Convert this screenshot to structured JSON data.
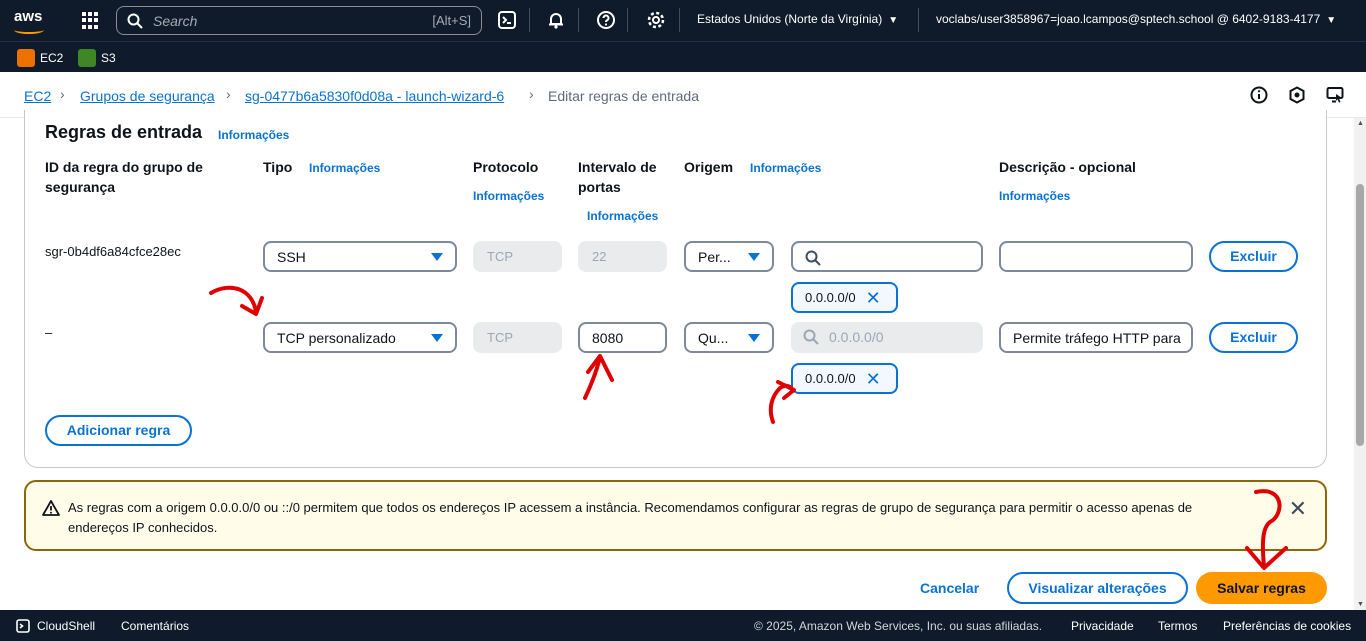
{
  "topbar": {
    "logo": "aws",
    "search_placeholder": "Search",
    "search_shortcut": "[Alt+S]",
    "region": "Estados Unidos (Norte da Virgínia)",
    "account": "voclabs/user3858967=joao.lcampos@sptech.school @ 6402-9183-4177",
    "icons": [
      "cloudshell-icon",
      "bell-icon",
      "help-icon",
      "gear-icon"
    ]
  },
  "favorites": [
    {
      "label": "EC2",
      "color": "#ed7100"
    },
    {
      "label": "S3",
      "color": "#3f8624"
    }
  ],
  "breadcrumb": {
    "items": [
      "EC2",
      "Grupos de segurança",
      "sg-0477b6a5830f0d08a - launch-wizard-6"
    ],
    "current": "Editar regras de entrada"
  },
  "panel": {
    "title": "Regras de entrada",
    "info_label": "Informações",
    "columns": {
      "rule_id": "ID da regra do grupo de segurança",
      "type": "Tipo",
      "protocol": "Protocolo",
      "port_range": "Intervalo de portas",
      "source": "Origem",
      "description": "Descrição - opcional"
    },
    "rows": [
      {
        "id": "sgr-0b4df6a84cfce28ec",
        "type": "SSH",
        "protocol": "TCP",
        "port": "22",
        "source_select": "Per...",
        "source_search": "",
        "source_token": "0.0.0.0/0",
        "description": "",
        "delete_label": "Excluir"
      },
      {
        "id": "–",
        "type": "TCP personalizado",
        "protocol": "TCP",
        "port": "8080",
        "source_select": "Qu...",
        "source_search": "0.0.0.0/0",
        "source_token": "0.0.0.0/0",
        "description": "Permite tráfego HTTP para",
        "delete_label": "Excluir"
      }
    ],
    "add_rule_label": "Adicionar regra"
  },
  "alert": {
    "message": "As regras com a origem 0.0.0.0/0 ou ::/0 permitem que todos os endereços IP acessem a instância. Recomendamos configurar as regras de grupo de segurança para permitir o acesso apenas de endereços IP conhecidos."
  },
  "actions": {
    "cancel": "Cancelar",
    "preview": "Visualizar alterações",
    "save": "Salvar regras"
  },
  "footer": {
    "cloudshell": "CloudShell",
    "feedback": "Comentários",
    "copyright": "© 2025, Amazon Web Services, Inc. ou suas afiliadas.",
    "privacy": "Privacidade",
    "terms": "Termos",
    "cookies": "Preferências de cookies"
  },
  "colors": {
    "nav_bg": "#0f1b2a",
    "link": "#0972d3",
    "primary": "#ff9900",
    "warning_border": "#8d6605",
    "annotation": "#e00000"
  }
}
